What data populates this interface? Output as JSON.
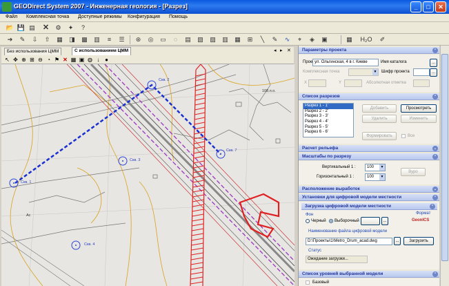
{
  "window": {
    "title": "GEODirect System 2007 - Инженерная геология - [Разрез]",
    "controls": {
      "minimize": "_",
      "maximize": "□",
      "close": "✕"
    }
  },
  "menu": [
    "Файл",
    "Комплексная точка",
    "Доступные режимы",
    "Конфигурация",
    "Помощь"
  ],
  "tabs": [
    "Без использования ЦММ",
    "С использованием ЦММ"
  ],
  "map": {
    "labels": [
      "Скв. 2",
      "Скв. 3",
      "Скв. 7",
      "Скв. 1",
      "Скв. 4",
      "108.п.о.",
      "Ас"
    ]
  },
  "panel": {
    "project_params": {
      "header": "Параметры проекта",
      "project_label": "Проект",
      "project_value": "ул. Ольгинская, 4 в г. Киеве",
      "catalog_label": "Имя каталога",
      "complex_point_label": "Комплексная точка",
      "cipher_label": "Шифр проекта",
      "x_label": "X",
      "y_label": "Y",
      "abs_label": "Абсолютная отметка"
    },
    "sections_list": {
      "header": "Список разрезов",
      "items": [
        "Разрез 1 - 1'",
        "Разрез 2 - 2'",
        "Разрез 3 - 3'",
        "Разрез 4 - 4'",
        "Разрез 5 - 5'",
        "Разрез 6 - 6'"
      ],
      "add_button": "Добавить",
      "view_button": "Просмотреть",
      "delete_button": "Удалить",
      "change_button": "Изменить",
      "form_button": "Формировать",
      "all_label": "Все"
    },
    "relief": {
      "header": "Расчет рельефа"
    },
    "scales": {
      "header": "Масштабы по разрезу",
      "vertical_label": "Вертикальный 1 :",
      "vertical_value": "100",
      "horizontal_label": "Горизонтальный 1 :",
      "horizontal_value": "100",
      "apply_button": "Вуро"
    },
    "workings": {
      "header": "Расположение выработок"
    },
    "dtm_settings": {
      "header": "Установки для цифровой модели местности",
      "load_header": "Загрузка цифровой модели местности",
      "bg_label": "Фон",
      "black_option": "Черный",
      "selected_option": "Выборочный",
      "format_label": "Формат",
      "format_value": "GeonICS",
      "file_name_label": "Наименование файла цифровой модели",
      "file_path": "D:\\Проекты\\1\\Metro_Drum_acad.dwg",
      "browse_button": "...",
      "load_button": "Загрузить",
      "status_label": "Статус",
      "status_value": "Ожидание загрузки..."
    },
    "dtm_levels": {
      "header": "Список уровней выбранной модели",
      "level0": "Базовый"
    }
  }
}
